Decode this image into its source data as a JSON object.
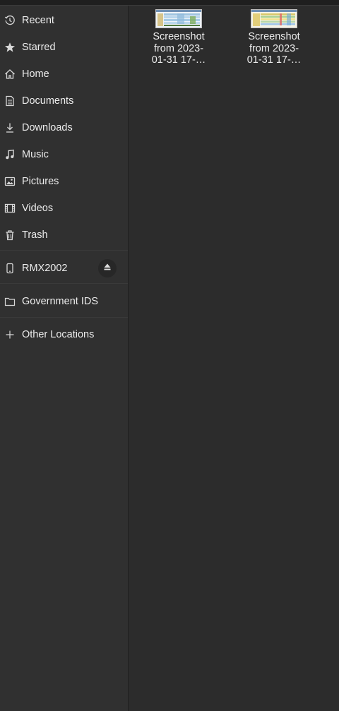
{
  "sidebar": {
    "items": [
      {
        "label": "Recent",
        "icon": "clock-icon"
      },
      {
        "label": "Starred",
        "icon": "star-icon"
      },
      {
        "label": "Home",
        "icon": "home-icon"
      },
      {
        "label": "Documents",
        "icon": "document-icon"
      },
      {
        "label": "Downloads",
        "icon": "download-icon"
      },
      {
        "label": "Music",
        "icon": "music-icon"
      },
      {
        "label": "Pictures",
        "icon": "picture-icon"
      },
      {
        "label": "Videos",
        "icon": "film-icon"
      },
      {
        "label": "Trash",
        "icon": "trash-icon"
      }
    ],
    "device": {
      "label": "RMX2002",
      "icon": "phone-icon",
      "eject_icon": "eject-icon"
    },
    "bookmark": {
      "label": "Government IDS",
      "icon": "folder-icon"
    },
    "other": {
      "label": "Other Locations",
      "icon": "plus-icon"
    }
  },
  "files": [
    {
      "line1": "Screenshot",
      "line2": "from 2023-",
      "line3": "01-31 17-…"
    },
    {
      "line1": "Screenshot",
      "line2": "from 2023-",
      "line3": "01-31 17-…"
    }
  ],
  "colors": {
    "sidebar_bg": "#303030",
    "main_bg": "#2c2c2c",
    "text": "#ececec"
  }
}
